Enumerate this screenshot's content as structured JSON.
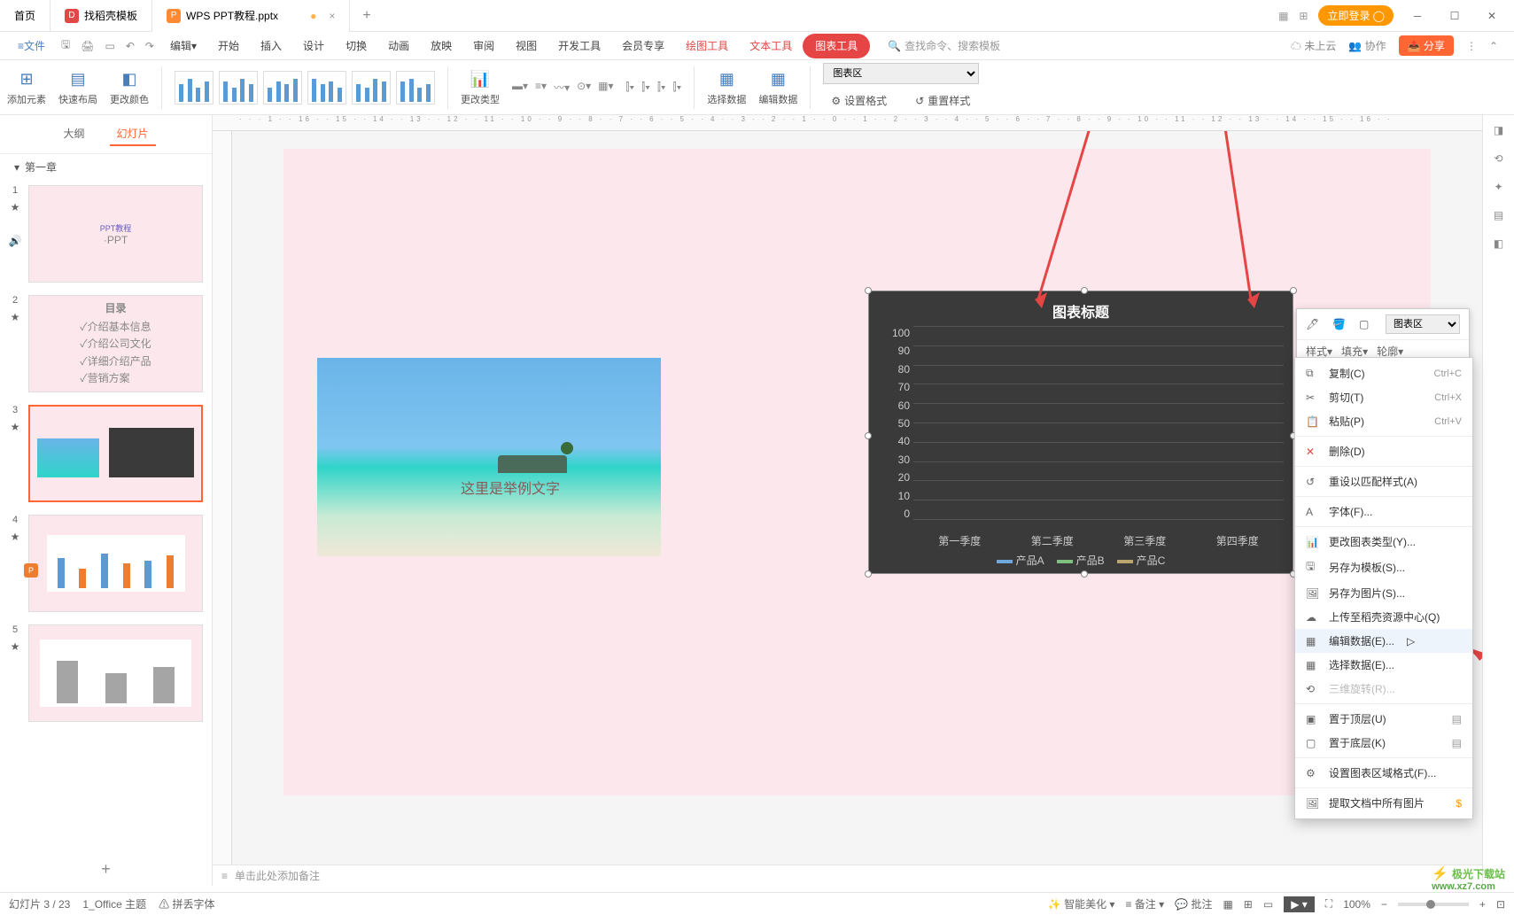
{
  "tabs": {
    "home": "首页",
    "template": "找稻壳模板",
    "doc": "WPS PPT教程.pptx"
  },
  "titlebar": {
    "login": "立即登录"
  },
  "menu": {
    "file": "文件",
    "edit": "编辑",
    "start": "开始",
    "insert": "插入",
    "design": "设计",
    "transition": "切换",
    "animation": "动画",
    "slideshow": "放映",
    "review": "审阅",
    "view": "视图",
    "dev": "开发工具",
    "vip": "会员专享",
    "draw": "绘图工具",
    "text": "文本工具",
    "chart": "图表工具",
    "search_ph": "查找命令、搜索模板",
    "cloud": "未上云",
    "collab": "协作",
    "share": "分享"
  },
  "ribbon": {
    "add_element": "添加元素",
    "quick_layout": "快速布局",
    "change_color": "更改颜色",
    "change_type": "更改类型",
    "select_data": "选择数据",
    "edit_data": "编辑数据",
    "chart_area": "图表区",
    "set_format": "设置格式",
    "reset_style": "重置样式"
  },
  "panel": {
    "outline": "大纲",
    "slides": "幻灯片",
    "chapter": "第一章"
  },
  "thumbs": {
    "t1a": "PPT教程",
    "t1b": "·PPT",
    "t2title": "目录",
    "t2_1": "✓介绍基本信息",
    "t2_2": "✓介绍公司文化",
    "t2_3": "✓详细介绍产品",
    "t2_4": "✓营销方案"
  },
  "slide": {
    "caption": "这里是举例文字",
    "chart_title": "图表标题"
  },
  "chart_data": {
    "type": "bar",
    "categories": [
      "第一季度",
      "第二季度",
      "第三季度",
      "第四季度"
    ],
    "series": [
      {
        "name": "产品A",
        "color": "#6fa8dc",
        "values": [
          2,
          2,
          2,
          2
        ]
      },
      {
        "name": "产品B",
        "color": "#7fbf7f",
        "values": [
          2,
          2,
          2,
          2
        ]
      },
      {
        "name": "产品C",
        "color": "#bba66f",
        "values": [
          2,
          2,
          2,
          2
        ]
      }
    ],
    "title": "图表标题",
    "xlabel": "",
    "ylabel": "",
    "ylim": [
      0,
      100
    ],
    "yticks": [
      0,
      10,
      20,
      30,
      40,
      50,
      60,
      70,
      80,
      90,
      100
    ]
  },
  "float": {
    "style": "样式",
    "fill": "填充",
    "outline": "轮廓",
    "area": "图表区"
  },
  "ctx": {
    "copy": "复制(C)",
    "copy_sc": "Ctrl+C",
    "cut": "剪切(T)",
    "cut_sc": "Ctrl+X",
    "paste": "粘贴(P)",
    "paste_sc": "Ctrl+V",
    "delete": "删除(D)",
    "reset_match": "重设以匹配样式(A)",
    "font": "字体(F)...",
    "change_chart": "更改图表类型(Y)...",
    "save_tpl": "另存为模板(S)...",
    "save_img": "另存为图片(S)...",
    "upload": "上传至稻壳资源中心(Q)",
    "edit_data": "编辑数据(E)...",
    "select_data": "选择数据(E)...",
    "rotate3d": "三维旋转(R)...",
    "bring_front": "置于顶层(U)",
    "send_back": "置于底层(K)",
    "format_area": "设置图表区域格式(F)...",
    "extract_img": "提取文档中所有图片"
  },
  "notes": {
    "placeholder": "单击此处添加备注"
  },
  "status": {
    "slide": "幻灯片 3 / 23",
    "theme": "1_Office 主题",
    "spell": "拼丢字体",
    "smart": "智能美化",
    "note": "备注",
    "comment": "批注",
    "zoom": "100%"
  },
  "watermark": {
    "site": "极光下载站",
    "url": "www.xz7.com"
  }
}
